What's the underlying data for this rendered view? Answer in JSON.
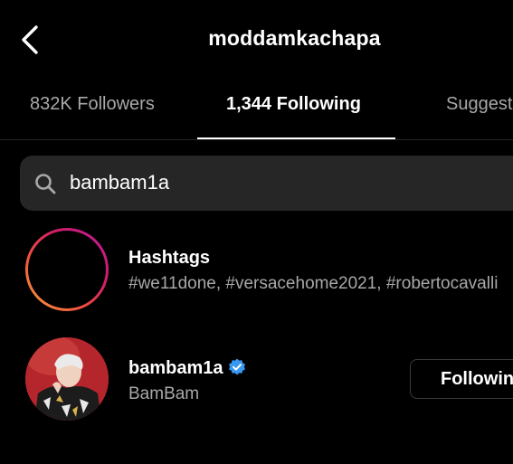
{
  "header": {
    "title": "moddamkachapa",
    "back_icon": "chevron-left-icon"
  },
  "tabs": [
    {
      "label": "832K Followers",
      "active": false
    },
    {
      "label": "1,344 Following",
      "active": true
    },
    {
      "label": "Suggested",
      "active": false
    }
  ],
  "search": {
    "icon": "search-icon",
    "value": "bambam1a"
  },
  "results": {
    "hashtags": {
      "title": "Hashtags",
      "subtitle": "#we11done, #versacehome2021, #robertocavalli",
      "icon": "hashtag-icon"
    },
    "user": {
      "username": "bambam1a",
      "full_name": "BamBam",
      "verified": true,
      "verified_icon": "verified-badge-icon",
      "button_label": "Following"
    }
  },
  "colors": {
    "background": "#000000",
    "text_primary": "#ffffff",
    "text_secondary": "#a8a8a8",
    "search_bg": "#262626",
    "verified": "#3897f0"
  }
}
